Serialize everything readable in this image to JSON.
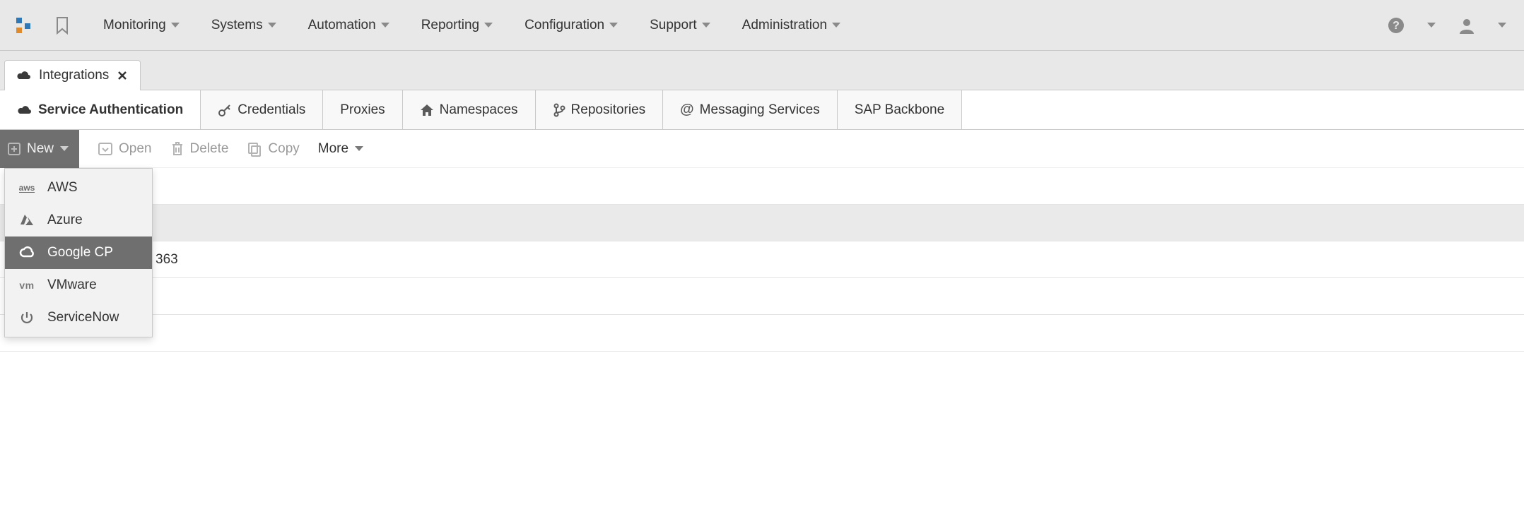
{
  "topnav": {
    "items": [
      {
        "label": "Monitoring"
      },
      {
        "label": "Systems"
      },
      {
        "label": "Automation"
      },
      {
        "label": "Reporting"
      },
      {
        "label": "Configuration"
      },
      {
        "label": "Support"
      },
      {
        "label": "Administration"
      }
    ]
  },
  "breadcrumb": {
    "label": "Integrations"
  },
  "tabs": [
    {
      "label": "Service Authentication",
      "active": true,
      "icon": "cloud"
    },
    {
      "label": "Credentials",
      "icon": "key"
    },
    {
      "label": "Proxies",
      "icon": "none"
    },
    {
      "label": "Namespaces",
      "icon": "home"
    },
    {
      "label": "Repositories",
      "icon": "branch"
    },
    {
      "label": "Messaging Services",
      "icon": "at"
    },
    {
      "label": "SAP Backbone",
      "icon": "none"
    }
  ],
  "toolbar": {
    "new_label": "New",
    "open_label": "Open",
    "delete_label": "Delete",
    "copy_label": "Copy",
    "more_label": "More"
  },
  "new_menu": {
    "items": [
      {
        "label": "AWS",
        "icon": "aws"
      },
      {
        "label": "Azure",
        "icon": "azure"
      },
      {
        "label": "Google CP",
        "icon": "gcp",
        "selected": true
      },
      {
        "label": "VMware",
        "icon": "vmware"
      },
      {
        "label": "ServiceNow",
        "icon": "power"
      }
    ]
  },
  "grid": {
    "visible_row_fragment": "363"
  }
}
